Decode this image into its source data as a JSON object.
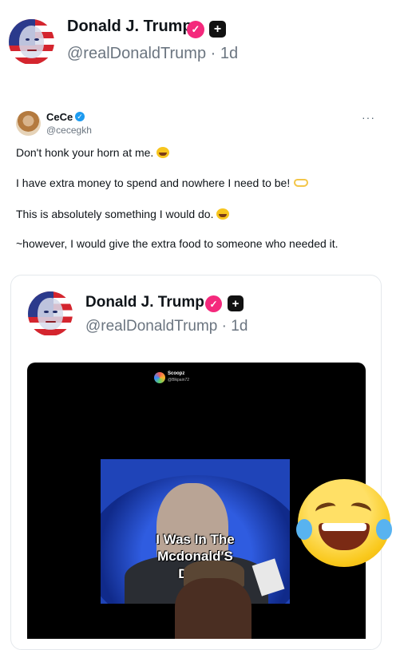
{
  "main_post": {
    "author": {
      "name": "Donald J. Trump",
      "handle": "@realDonaldTrump",
      "time": "1d",
      "separator": "·"
    }
  },
  "reply_post": {
    "author": {
      "name": "CeCe",
      "handle": "@cecegkh"
    },
    "menu_label": "···",
    "lines": [
      "Don't honk your horn at me.",
      "I have extra money to spend and nowhere I need to be!",
      "This is absolutely something I would do.",
      "~however, I would give the extra food to someone who needed it."
    ],
    "emojis": [
      "rolling-on-floor-laughing",
      "heart-hands",
      "rolling-on-floor-laughing"
    ]
  },
  "quoted_post": {
    "author": {
      "name": "Donald J. Trump",
      "handle": "@realDonaldTrump",
      "time": "1d",
      "separator": "·"
    },
    "video": {
      "watermark_name": "Scoopz",
      "watermark_handle": "@Blkpain72",
      "caption_lines": [
        "I Was In The",
        "Mcdonald'S",
        "Drive"
      ]
    }
  },
  "colors": {
    "verified_pink": "#f4297c",
    "verified_blue": "#1d9bf0",
    "muted_text": "#6b7580"
  }
}
